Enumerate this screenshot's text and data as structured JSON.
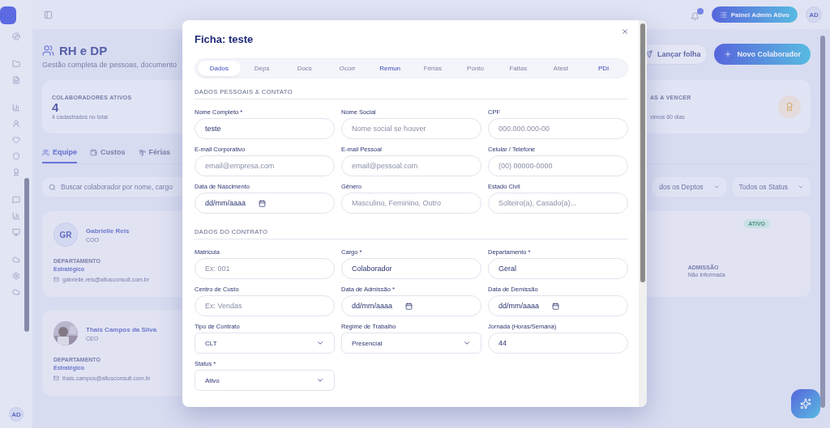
{
  "topbar": {
    "admin_button": "Painel Admin Ativo",
    "avatar": "AD"
  },
  "sidebar": {
    "avatar": "AD"
  },
  "page": {
    "title": "RH e DP",
    "subtitle": "Gestão completa de pessoas, documento",
    "actions": [
      {
        "kind": "secondary",
        "label": "Lançar folha"
      },
      {
        "kind": "primary",
        "label": "Novo Colaborador"
      }
    ],
    "stats": [
      {
        "label": "COLABORADORES ATIVOS",
        "value": "4",
        "note": "4 cadastrados no total"
      },
      {
        "label": "AS A VENCER",
        "note": "ximos 60 dias"
      }
    ],
    "tabs": [
      {
        "label": "Equipe",
        "selected": true
      },
      {
        "label": "Custos",
        "selected": false
      },
      {
        "label": "Férias",
        "selected": false
      }
    ],
    "search_placeholder": "Buscar colaborador por nome, cargo",
    "filters": [
      "dos os Deptos",
      "Todos os Status"
    ],
    "employees": [
      {
        "kind": "initials",
        "initials": "GR",
        "name": "Gabrielle Reis",
        "role": "COO",
        "dept_label": "DEPARTAMENTO",
        "dept": "Estratégico",
        "email": "gabrielle.reis@altusconsult.com.br"
      },
      {
        "badge": "ATIVO",
        "admission_label": "ADMISSÃO",
        "admission": "Não informada"
      },
      {
        "kind": "picture",
        "name": "Thais Campos da Silva",
        "role": "CEO",
        "dept_label": "DEPARTAMENTO",
        "dept": "Estratégico",
        "email": "thais.campos@altusconsult.com.br"
      }
    ]
  },
  "modal": {
    "title": "Ficha: teste",
    "tabs": [
      {
        "label": "Dados",
        "selected": true,
        "accent": false
      },
      {
        "label": "Deps",
        "selected": false,
        "accent": false
      },
      {
        "label": "Docs",
        "selected": false,
        "accent": false
      },
      {
        "label": "Ocorr",
        "selected": false,
        "accent": false
      },
      {
        "label": "Remun",
        "selected": false,
        "accent": true
      },
      {
        "label": "Férias",
        "selected": false,
        "accent": false
      },
      {
        "label": "Ponto",
        "selected": false,
        "accent": false
      },
      {
        "label": "Faltas",
        "selected": false,
        "accent": false
      },
      {
        "label": "Atest",
        "selected": false,
        "accent": false
      },
      {
        "label": "PDI",
        "selected": false,
        "accent": true
      }
    ],
    "sections": [
      {
        "title": "DADOS PESSOAIS & CONTATO",
        "fields": [
          {
            "kind": "text",
            "label": "Nome Completo *",
            "value": "teste"
          },
          {
            "kind": "text",
            "label": "Nome Social",
            "placeholder": "Nome social se houver"
          },
          {
            "kind": "text",
            "label": "CPF",
            "placeholder": "000.000.000-00"
          },
          {
            "kind": "text",
            "label": "E-mail Corporativo",
            "placeholder": "email@empresa.com"
          },
          {
            "kind": "text",
            "label": "E-mail Pessoal",
            "placeholder": "email@pessoal.com"
          },
          {
            "kind": "text",
            "label": "Celular / Telefone",
            "placeholder": "(00) 00000-0000"
          },
          {
            "kind": "date",
            "label": "Data de Nascimento",
            "value": "dd/mm/aaaa"
          },
          {
            "kind": "text",
            "label": "Gênero",
            "placeholder": "Masculino, Feminino, Outro"
          },
          {
            "kind": "text",
            "label": "Estado Civil",
            "placeholder": "Solteiro(a), Casado(a)..."
          }
        ]
      },
      {
        "title": "DADOS DO CONTRATO",
        "fields": [
          {
            "kind": "text",
            "label": "Matrícula",
            "placeholder": "Ex: 001"
          },
          {
            "kind": "text",
            "label": "Cargo *",
            "value": "Colaborador"
          },
          {
            "kind": "text",
            "label": "Departamento *",
            "value": "Geral"
          },
          {
            "kind": "text",
            "label": "Centro de Custo",
            "placeholder": "Ex: Vendas"
          },
          {
            "kind": "date",
            "label": "Data de Admissão *",
            "value": "dd/mm/aaaa"
          },
          {
            "kind": "date",
            "label": "Data de Demissão",
            "value": "dd/mm/aaaa"
          },
          {
            "kind": "select",
            "label": "Tipo de Contrato",
            "value": "CLT"
          },
          {
            "kind": "select",
            "label": "Regime de Trabalho",
            "value": "Presencial"
          },
          {
            "kind": "text",
            "label": "Jornada (Horas/Semana)",
            "value": "44"
          },
          {
            "kind": "select",
            "label": "Status *",
            "value": "Ativo"
          }
        ]
      }
    ]
  }
}
